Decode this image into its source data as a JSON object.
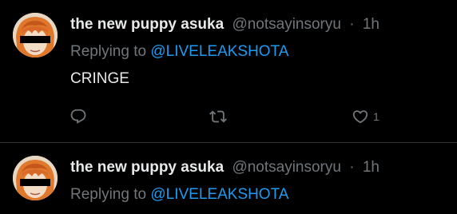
{
  "tweets": [
    {
      "author_name": "the new puppy asuka",
      "author_handle": "@notsayinsoryu",
      "separator": "·",
      "timestamp": "1h",
      "replying_prefix": "Replying to",
      "replying_to": "@LIVELEAKSHOTA",
      "text": "CRINGE",
      "like_count": "1"
    },
    {
      "author_name": "the new puppy asuka",
      "author_handle": "@notsayinsoryu",
      "separator": "·",
      "timestamp": "1h",
      "replying_prefix": "Replying to",
      "replying_to": "@LIVELEAKSHOTA"
    }
  ],
  "icons": {
    "reply": "reply-icon",
    "retweet": "retweet-icon",
    "like": "heart-icon"
  },
  "colors": {
    "background": "#000000",
    "primary_text": "#e7e9ea",
    "secondary_text": "#71767b",
    "link": "#1d9bf0",
    "divider": "#2f3336"
  }
}
